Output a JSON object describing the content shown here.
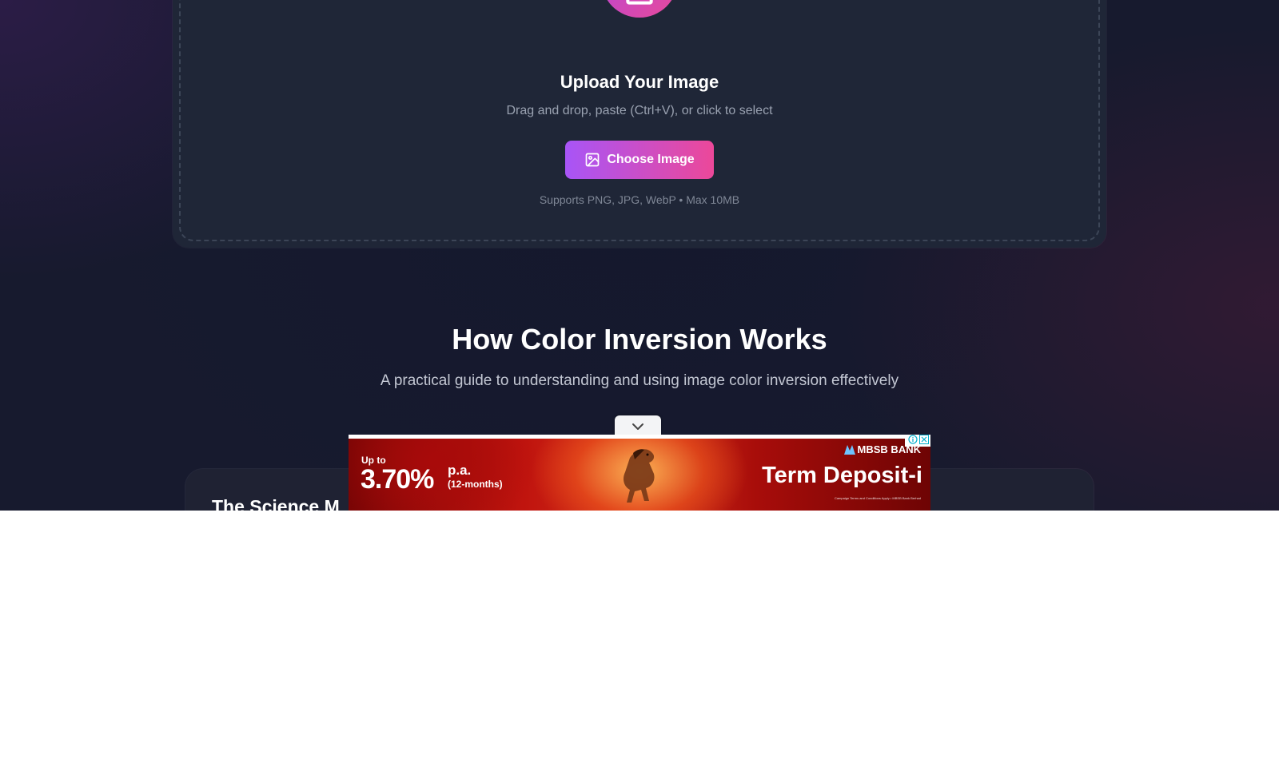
{
  "upload": {
    "title": "Upload Your Image",
    "subtitle": "Drag and drop, paste (Ctrl+V), or click to select",
    "button_label": "Choose Image",
    "supports": "Supports PNG, JPG, WebP • Max 10MB",
    "upload_icon": "upload-arrow-icon",
    "button_icon": "image-icon"
  },
  "how": {
    "title": "How Color Inversion Works",
    "subtitle": "A practical guide to understanding and using image color inversion effectively"
  },
  "science": {
    "title": "The Science M"
  },
  "ad": {
    "up_to": "Up to",
    "rate": "3.70%",
    "pa": "p.a.",
    "months": "(12-months)",
    "bank": "MBSB BANK",
    "product": "Term Deposit-i",
    "fine_print": "Campaign Terms and Conditions Apply  •  MBSB Bank Berhad",
    "collapse_icon": "chevron-down-icon",
    "adchoices_icons": [
      "info-icon",
      "close-icon"
    ]
  },
  "colors": {
    "accent_start": "#a855f7",
    "accent_end": "#ec4899",
    "background": "#171a2e",
    "card": "#1f2637"
  }
}
